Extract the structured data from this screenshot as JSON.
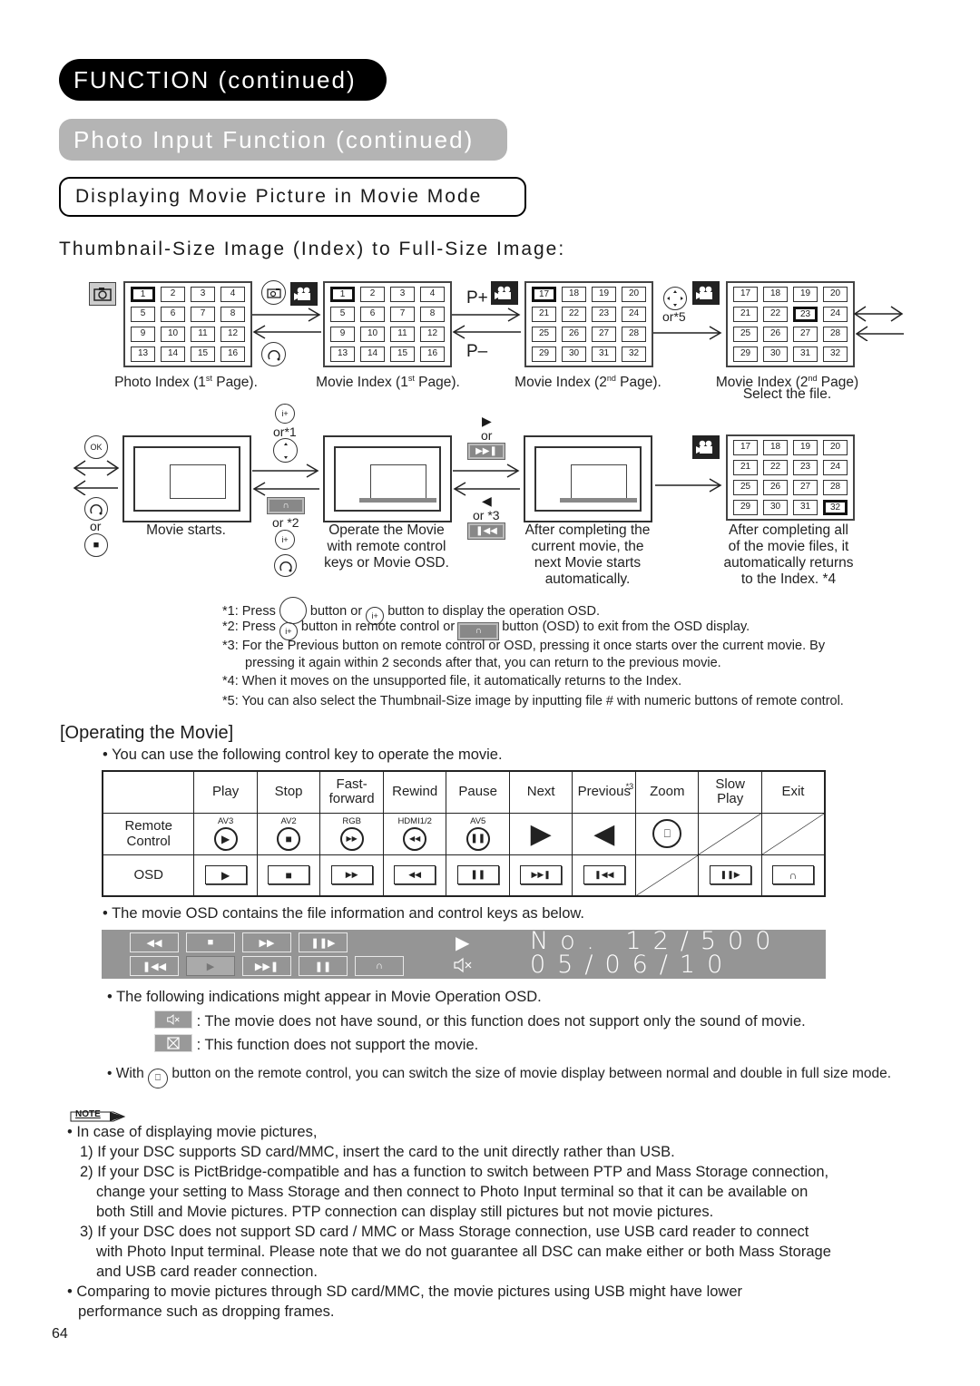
{
  "headers": {
    "section": "FUNCTION (continued)",
    "subsection": "Photo Input Function (continued)",
    "topic": "Displaying Movie Picture in Movie Mode",
    "subtopic": "Thumbnail-Size Image (Index) to Full-Size Image:"
  },
  "index_flow": {
    "photo_index": {
      "cells": [
        "1",
        "2",
        "3",
        "4",
        "5",
        "6",
        "7",
        "8",
        "9",
        "10",
        "11",
        "12",
        "13",
        "14",
        "15",
        "16"
      ],
      "selected": "1",
      "caption_a": "Photo Index (1",
      "caption_sup": "st",
      "caption_b": " Page)."
    },
    "movie_index_1": {
      "cells": [
        "1",
        "2",
        "3",
        "4",
        "5",
        "6",
        "7",
        "8",
        "9",
        "10",
        "11",
        "12",
        "13",
        "14",
        "15",
        "16"
      ],
      "selected": "1",
      "caption_a": "Movie Index (1",
      "caption_sup": "st",
      "caption_b": " Page)."
    },
    "movie_index_2": {
      "cells": [
        "17",
        "18",
        "19",
        "20",
        "21",
        "22",
        "23",
        "24",
        "25",
        "26",
        "27",
        "28",
        "29",
        "30",
        "31",
        "32"
      ],
      "selected": "17",
      "caption_a": "Movie Index (2",
      "caption_sup": "nd",
      "caption_b": " Page)."
    },
    "movie_index_select": {
      "cells": [
        "17",
        "18",
        "19",
        "20",
        "21",
        "22",
        "23",
        "24",
        "25",
        "26",
        "27",
        "28",
        "29",
        "30",
        "31",
        "32"
      ],
      "selected": "23",
      "caption_a": "Movie Index (2",
      "caption_sup": "nd",
      "caption_b": " Page)",
      "caption_line2": "Select the file."
    },
    "p_plus": "P+",
    "p_minus": "P–",
    "or5": "or*5"
  },
  "movie_flow": {
    "ok_label": "OK",
    "or": "or",
    "or1": "or*1",
    "or2": "or *2",
    "or3": "or *3",
    "movie_starts": "Movie starts.",
    "operate": [
      "Operate the Movie",
      "with remote control",
      "keys or Movie OSD."
    ],
    "after_current": [
      "After completing the",
      "current movie, the",
      "next Movie starts",
      "automatically."
    ],
    "after_all": [
      "After completing all",
      "of the movie files, it",
      "automatically returns",
      "to the Index. *4"
    ],
    "return_index": {
      "cells": [
        "17",
        "18",
        "19",
        "20",
        "21",
        "22",
        "23",
        "24",
        "25",
        "26",
        "27",
        "28",
        "29",
        "30",
        "31",
        "32"
      ],
      "selected": "32"
    }
  },
  "footnotes": {
    "f1_a": "*1: Press",
    "f1_b": "button or",
    "f1_c": "button to display the operation OSD.",
    "f2_a": "*2: Press",
    "f2_b": "button in remote control or",
    "f2_c": "button (OSD) to exit from the OSD display.",
    "f3_a": "*3: For the Previous button on remote control or OSD, pressing it once starts over the current movie. By",
    "f3_b": "pressing it again within 2 seconds after that, you can return to the previous movie.",
    "f4": "*4: When it moves on the unsupported file, it automatically returns to the Index.",
    "f5": "*5: You can also select the Thumbnail-Size image by inputting file # with numeric buttons of remote control."
  },
  "operating": {
    "title": "[Operating the Movie]",
    "intro": "• You can use the following control key to operate the movie.",
    "columns": [
      {
        "label": "Play",
        "remote_label": "AV3",
        "remote_icon": "▶",
        "osd_icon": "▶"
      },
      {
        "label": "Stop",
        "remote_label": "AV2",
        "remote_icon": "■",
        "osd_icon": "■"
      },
      {
        "label_1": "Fast-",
        "label_2": "forward",
        "remote_label": "RGB",
        "remote_icon": "▶▶",
        "osd_icon": "▶▶"
      },
      {
        "label": "Rewind",
        "remote_label": "HDMI1/2",
        "remote_icon": "◀◀",
        "osd_icon": "◀◀"
      },
      {
        "label": "Pause",
        "remote_label": "AV5",
        "remote_icon": "❚❚",
        "osd_icon": "❚❚"
      },
      {
        "label": "Next",
        "remote_icon": "▶",
        "osd_icon": "▶▶❚"
      },
      {
        "label": "Previous",
        "note": "*3",
        "remote_icon": "◀",
        "osd_icon": "❚◀◀"
      },
      {
        "label": "Zoom",
        "remote_icon": "⎕"
      },
      {
        "label_1": "Slow",
        "label_2": "Play",
        "osd_icon": "❚❚▶"
      },
      {
        "label": "Exit",
        "osd_icon": "∩"
      }
    ],
    "row_remote_1": "Remote",
    "row_remote_2": "Control",
    "row_osd": "OSD"
  },
  "osd_panel": {
    "intro": "• The movie OSD contains the file information and control keys as below.",
    "keys_top": [
      "◀◀",
      "■",
      "▶▶",
      "❚❚▶"
    ],
    "keys_bottom": [
      "❚◀◀",
      "▶",
      "▶▶❚",
      "❚❚",
      "∩"
    ],
    "status_icon": "▶",
    "mute_icon": "🔇",
    "file_number": "No. 12∕500",
    "date": "05∕06∕10"
  },
  "indications": {
    "intro": "• The following indications might appear in Movie Operation OSD.",
    "no_sound": ": The movie does not have sound, or this function does not support only the sound of movie.",
    "not_supported": ": This function does not support the movie.",
    "with_a": "• With",
    "with_b": "button on the remote control, you can switch the size of movie display between normal and double in full size mode."
  },
  "note": {
    "badge": "NOTE",
    "lines": [
      "• In case of displaying movie pictures,",
      "1) If your DSC supports SD card/MMC, insert the card to the unit directly rather than USB.",
      "2) If your DSC is PictBridge-compatible and has a function to switch between PTP and Mass Storage connection,",
      "change your setting to Mass Storage and then connect to Photo Input terminal so that it can be available on",
      "both Still and Movie pictures. PTP connection can display still pictures but not movie pictures.",
      "3) If your DSC does not support SD card / MMC or Mass Storage connection, use USB card reader to connect",
      "with Photo Input terminal. Please note that we do not guarantee all DSC can make either or both Mass Storage",
      "and USB card reader connection.",
      "• Comparing to movie pictures through SD card/MMC, the movie pictures using USB might have lower",
      "performance such as dropping frames."
    ]
  },
  "page_number": "64",
  "colors": {
    "header_black": "#000000",
    "header_gray": "#b4b4b4",
    "osd_gray": "#959595"
  }
}
